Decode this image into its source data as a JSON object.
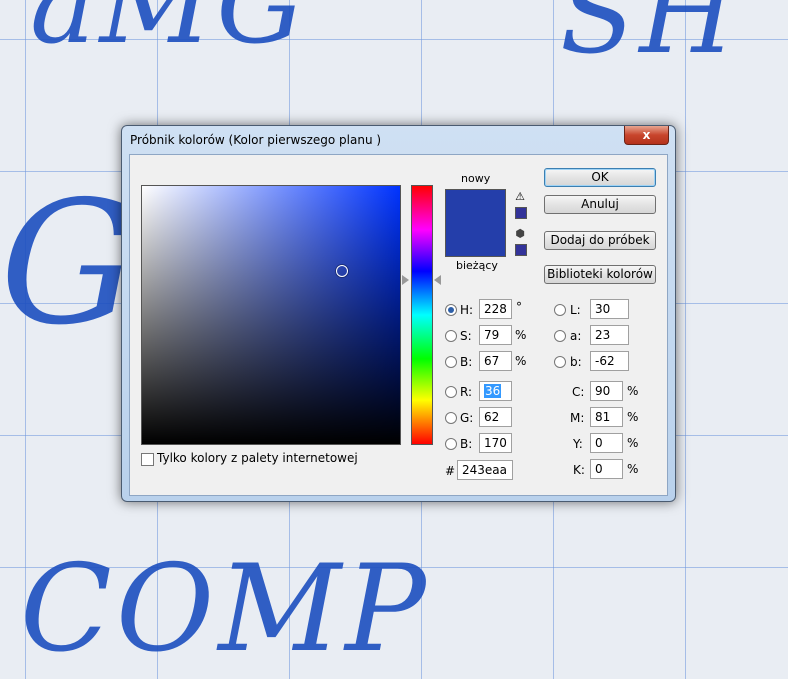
{
  "dialog": {
    "title": "Próbnik kolorów (Kolor pierwszego planu )",
    "close_label": "x"
  },
  "background_writing": [
    "aMG",
    "GA",
    "COMP",
    "SH"
  ],
  "swatch": {
    "new_label": "nowy",
    "current_label": "bieżący",
    "new_color": "#243eaa",
    "current_color": "#243eaa",
    "web_color": "#333399",
    "warning_icon": "warning-triangle-icon",
    "cube_icon": "web-safe-cube-icon"
  },
  "buttons": {
    "ok": "OK",
    "cancel": "Anuluj",
    "add_to_swatches": "Dodaj do próbek",
    "color_libraries": "Biblioteki kolorów"
  },
  "hsb": {
    "h": {
      "label": "H:",
      "value": "228",
      "unit": "°"
    },
    "s": {
      "label": "S:",
      "value": "79",
      "unit": "%"
    },
    "b": {
      "label": "B:",
      "value": "67",
      "unit": "%"
    }
  },
  "rgb": {
    "r": {
      "label": "R:",
      "value": "36"
    },
    "g": {
      "label": "G:",
      "value": "62"
    },
    "b": {
      "label": "B:",
      "value": "170"
    }
  },
  "hex": {
    "label": "#",
    "value": "243eaa"
  },
  "lab": {
    "l": {
      "label": "L:",
      "value": "30"
    },
    "a": {
      "label": "a:",
      "value": "23"
    },
    "b": {
      "label": "b:",
      "value": "-62"
    }
  },
  "cmyk": {
    "c": {
      "label": "C:",
      "value": "90",
      "unit": "%"
    },
    "m": {
      "label": "M:",
      "value": "81",
      "unit": "%"
    },
    "y": {
      "label": "Y:",
      "value": "0",
      "unit": "%"
    },
    "k": {
      "label": "K:",
      "value": "0",
      "unit": "%"
    }
  },
  "web_only": {
    "label": "Tylko kolory z palety internetowej",
    "checked": false
  },
  "selected_mode": "H"
}
